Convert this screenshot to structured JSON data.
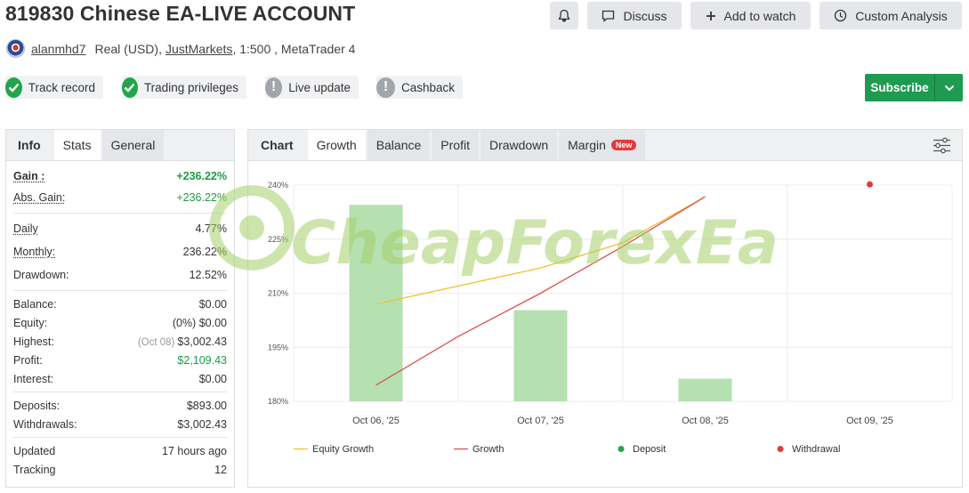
{
  "header": {
    "title": "819830 Chinese EA-LIVE ACCOUNT",
    "discuss_label": "Discuss",
    "watch_label": "Add to watch",
    "analysis_label": "Custom Analysis"
  },
  "account": {
    "username": "alanmhd7",
    "type": "Real (USD),",
    "broker": "JustMarkets",
    "leverage_platform": ", 1:500 , MetaTrader 4"
  },
  "badges": [
    {
      "label": "Track record",
      "state": "ok"
    },
    {
      "label": "Trading privileges",
      "state": "ok"
    },
    {
      "label": "Live update",
      "state": "warn"
    },
    {
      "label": "Cashback",
      "state": "warn"
    }
  ],
  "subscribe_label": "Subscribe",
  "left_tabs": [
    "Info",
    "Stats",
    "General"
  ],
  "stats": {
    "gain": {
      "label": "Gain :",
      "value": "+236.22%"
    },
    "abs_gain": {
      "label": "Abs. Gain:",
      "value": "+236.22%"
    },
    "daily": {
      "label": "Daily",
      "value": "4.77%"
    },
    "monthly": {
      "label": "Monthly:",
      "value": "236.22%"
    },
    "drawdown": {
      "label": "Drawdown:",
      "value": "12.52%"
    },
    "balance": {
      "label": "Balance:",
      "value": "$0.00"
    },
    "equity": {
      "label": "Equity:",
      "pct": "(0%)",
      "value": "$0.00"
    },
    "highest": {
      "label": "Highest:",
      "date": "(Oct 08)",
      "value": "$3,002.43"
    },
    "profit": {
      "label": "Profit:",
      "value": "$2,109.43"
    },
    "interest": {
      "label": "Interest:",
      "value": "$0.00"
    },
    "deposits": {
      "label": "Deposits:",
      "value": "$893.00"
    },
    "withdrawals": {
      "label": "Withdrawals:",
      "value": "$3,002.43"
    },
    "updated": {
      "label": "Updated",
      "value": "17 hours ago"
    },
    "tracking": {
      "label": "Tracking",
      "value": "12"
    }
  },
  "chart_tabs": {
    "title": "Chart",
    "items": [
      "Growth",
      "Balance",
      "Profit",
      "Drawdown",
      "Margin"
    ],
    "new_tag": "New"
  },
  "watermark": "CheapForexEa",
  "colors": {
    "green": "#1e9b51",
    "bar": "#b5e0b0",
    "equity_line": "#f2c12e",
    "growth_line": "#d9534f",
    "deposit": "#22a64a",
    "withdrawal": "#e03c3c"
  },
  "chart_data": {
    "type": "bar",
    "categories": [
      "Oct 06, '25",
      "Oct 07, '25",
      "Oct 08, '25",
      "Oct 09, '25"
    ],
    "y_ticks": [
      "240%",
      "225%",
      "210%",
      "195%",
      "180%"
    ],
    "ylim": [
      180,
      240
    ],
    "bars": [
      234.5,
      205.3,
      186.3,
      null
    ],
    "series": [
      {
        "name": "Equity Growth",
        "type": "line",
        "x": [
          0,
          0.5,
          1,
          1.5,
          2
        ],
        "values": [
          207,
          212,
          217,
          224,
          236.8
        ]
      },
      {
        "name": "Growth",
        "type": "line",
        "x": [
          0,
          0.5,
          1,
          1.5,
          2
        ],
        "values": [
          184.5,
          198,
          210,
          223,
          236.8
        ]
      }
    ],
    "withdrawal_point": {
      "x": 3,
      "value": 240.2
    },
    "legend": [
      "Equity Growth",
      "Growth",
      "Deposit",
      "Withdrawal"
    ],
    "legend_position": "bottom",
    "grid": true
  }
}
